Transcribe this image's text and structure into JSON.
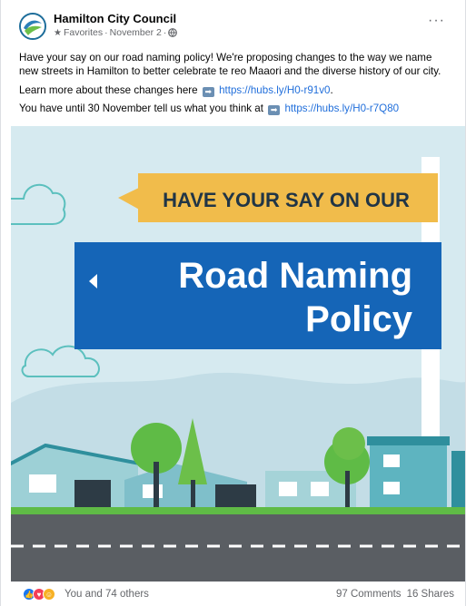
{
  "post": {
    "page_name": "Hamilton City Council",
    "meta": {
      "favorites": "Favorites",
      "separator": "·",
      "date": "November 2",
      "dot": "·"
    },
    "text": {
      "line1": "Have your say on our road naming policy! We're proposing changes to the way we name new streets in Hamilton to better celebrate te reo Maaori and the diverse history of our city.",
      "line2_pre": "Learn more about these changes here",
      "line2_link": "https://hubs.ly/H0-r91v0",
      "line2_post": ".",
      "line3_pre": "You have until 30 November tell us what you think at",
      "line3_link": "https://hubs.ly/H0-r7Q80"
    },
    "image": {
      "top_sign": "HAVE YOUR SAY ON OUR",
      "main_sign_line1": "Road Naming",
      "main_sign_line2": "Policy"
    },
    "footer": {
      "reactions_text": "You and 74 others",
      "comments": "97 Comments",
      "shares": "16 Shares"
    }
  },
  "colors": {
    "sky": "#d6eaf0",
    "top_sign": "#f1bc4b",
    "main_sign": "#1565b7",
    "road": "#5a5e63",
    "grass": "#5fbb46",
    "link": "#216fdb"
  },
  "icons": {
    "more": "more-options-icon",
    "globe": "globe-icon",
    "star": "star-icon",
    "arrow": "right-arrow-emoji-icon"
  }
}
